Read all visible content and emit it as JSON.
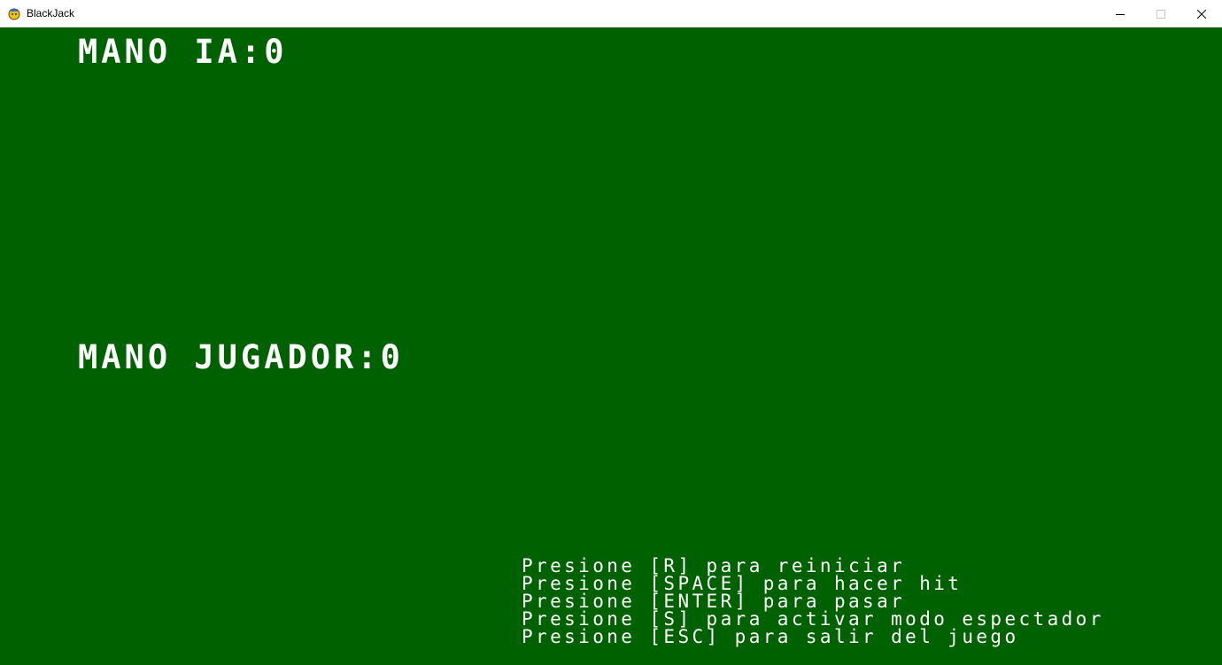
{
  "window": {
    "title": "BlackJack",
    "icon": "pygame-snake-icon"
  },
  "controls": {
    "minimize": "minimize-icon",
    "maximize": "maximize-icon",
    "close": "close-icon"
  },
  "colors": {
    "table_green": "#006100",
    "text": "#ffffff"
  },
  "game": {
    "ai_hand_label": "MANO IA:0",
    "player_hand_label": "MANO JUGADOR:0",
    "instructions": [
      "Presione [R] para reiniciar",
      "Presione [SPACE] para hacer hit",
      "Presione [ENTER] para pasar",
      "Presione [S] para activar modo espectador",
      "Presione [ESC] para salir del juego"
    ]
  }
}
